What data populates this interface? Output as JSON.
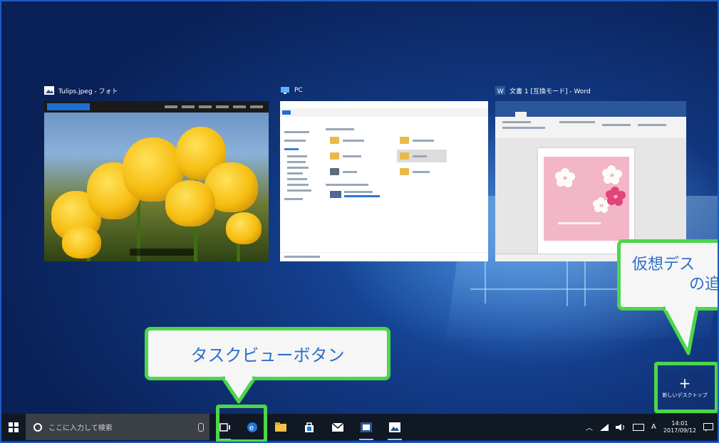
{
  "windows": [
    {
      "title": "Tulips.jpeg - フォト",
      "icon": "photos-icon"
    },
    {
      "title": "PC",
      "icon": "explorer-pc-icon"
    },
    {
      "title": "文書 1 [互換モード] - Word",
      "icon": "word-icon"
    }
  ],
  "new_desktop": {
    "plus": "+",
    "label": "新しいデスクトップ"
  },
  "callouts": {
    "taskview": "タスクビューボタン",
    "new_desktop_line1": "仮想デス",
    "new_desktop_line2": "の追"
  },
  "taskbar": {
    "search_placeholder": "ここに入力して検索",
    "ime": "A",
    "time": "14:01",
    "date": "2017/09/12"
  },
  "colors": {
    "highlight": "#4cd64a",
    "callout_text": "#2c6fc9",
    "taskbar": "#101823"
  }
}
